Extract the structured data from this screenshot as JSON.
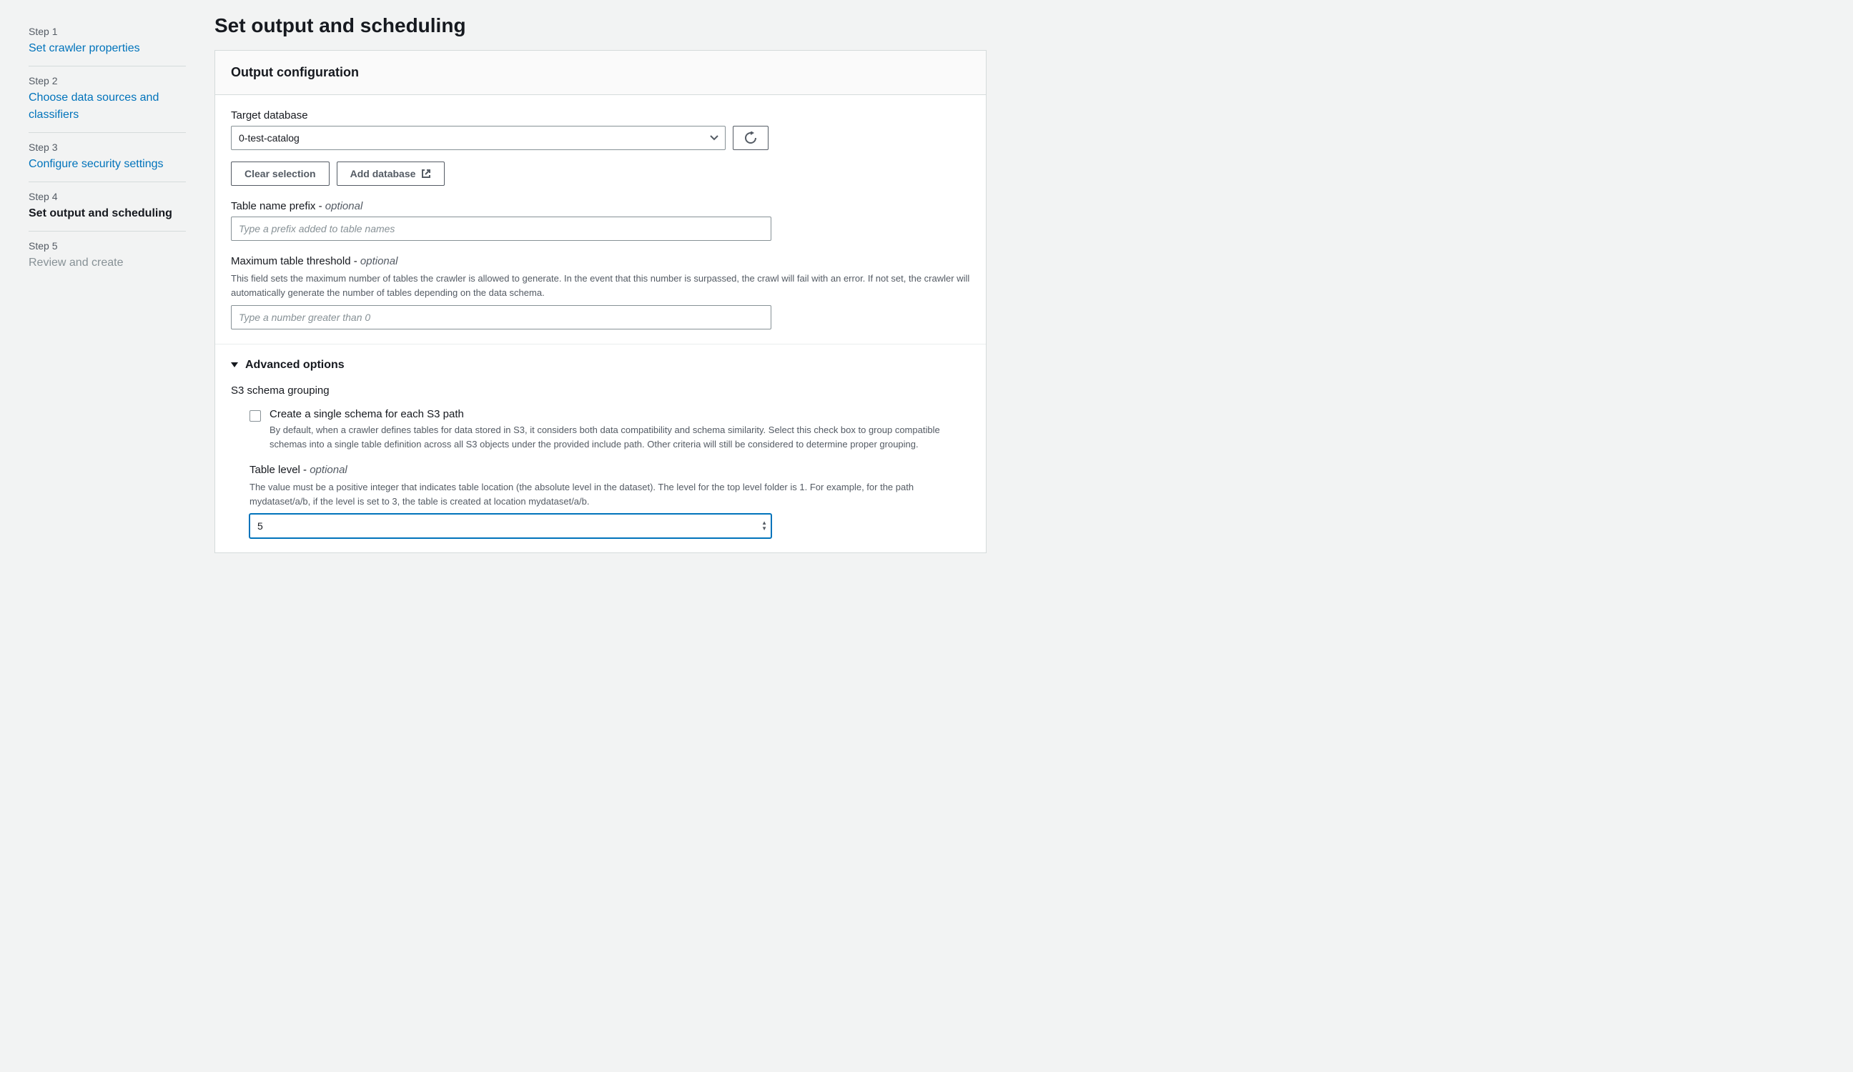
{
  "sidebar": {
    "steps": [
      {
        "num": "Step 1",
        "label": "Set crawler properties"
      },
      {
        "num": "Step 2",
        "label": "Choose data sources and classifiers"
      },
      {
        "num": "Step 3",
        "label": "Configure security settings"
      },
      {
        "num": "Step 4",
        "label": "Set output and scheduling"
      },
      {
        "num": "Step 5",
        "label": "Review and create"
      }
    ]
  },
  "page": {
    "title": "Set output and scheduling"
  },
  "output": {
    "panel_title": "Output configuration",
    "target_db_label": "Target database",
    "target_db_value": "0-test-catalog",
    "clear_selection": "Clear selection",
    "add_database": "Add database",
    "prefix_label": "Table name prefix - ",
    "prefix_optional": "optional",
    "prefix_placeholder": "Type a prefix added to table names",
    "threshold_label": "Maximum table threshold - ",
    "threshold_optional": "optional",
    "threshold_help": "This field sets the maximum number of tables the crawler is allowed to generate. In the event that this number is surpassed, the crawl will fail with an error. If not set, the crawler will automatically generate the number of tables depending on the data schema.",
    "threshold_placeholder": "Type a number greater than 0"
  },
  "advanced": {
    "title": "Advanced options",
    "s3_heading": "S3 schema grouping",
    "single_schema_label": "Create a single schema for each S3 path",
    "single_schema_help": "By default, when a crawler defines tables for data stored in S3, it considers both data compatibility and schema similarity. Select this check box to group compatible schemas into a single table definition across all S3 objects under the provided include path. Other criteria will still be considered to determine proper grouping.",
    "table_level_label": "Table level - ",
    "table_level_optional": "optional",
    "table_level_help": "The value must be a positive integer that indicates table location (the absolute level in the dataset). The level for the top level folder is 1. For example, for the path mydataset/a/b, if the level is set to 3, the table is created at location mydataset/a/b.",
    "table_level_value": "5"
  }
}
